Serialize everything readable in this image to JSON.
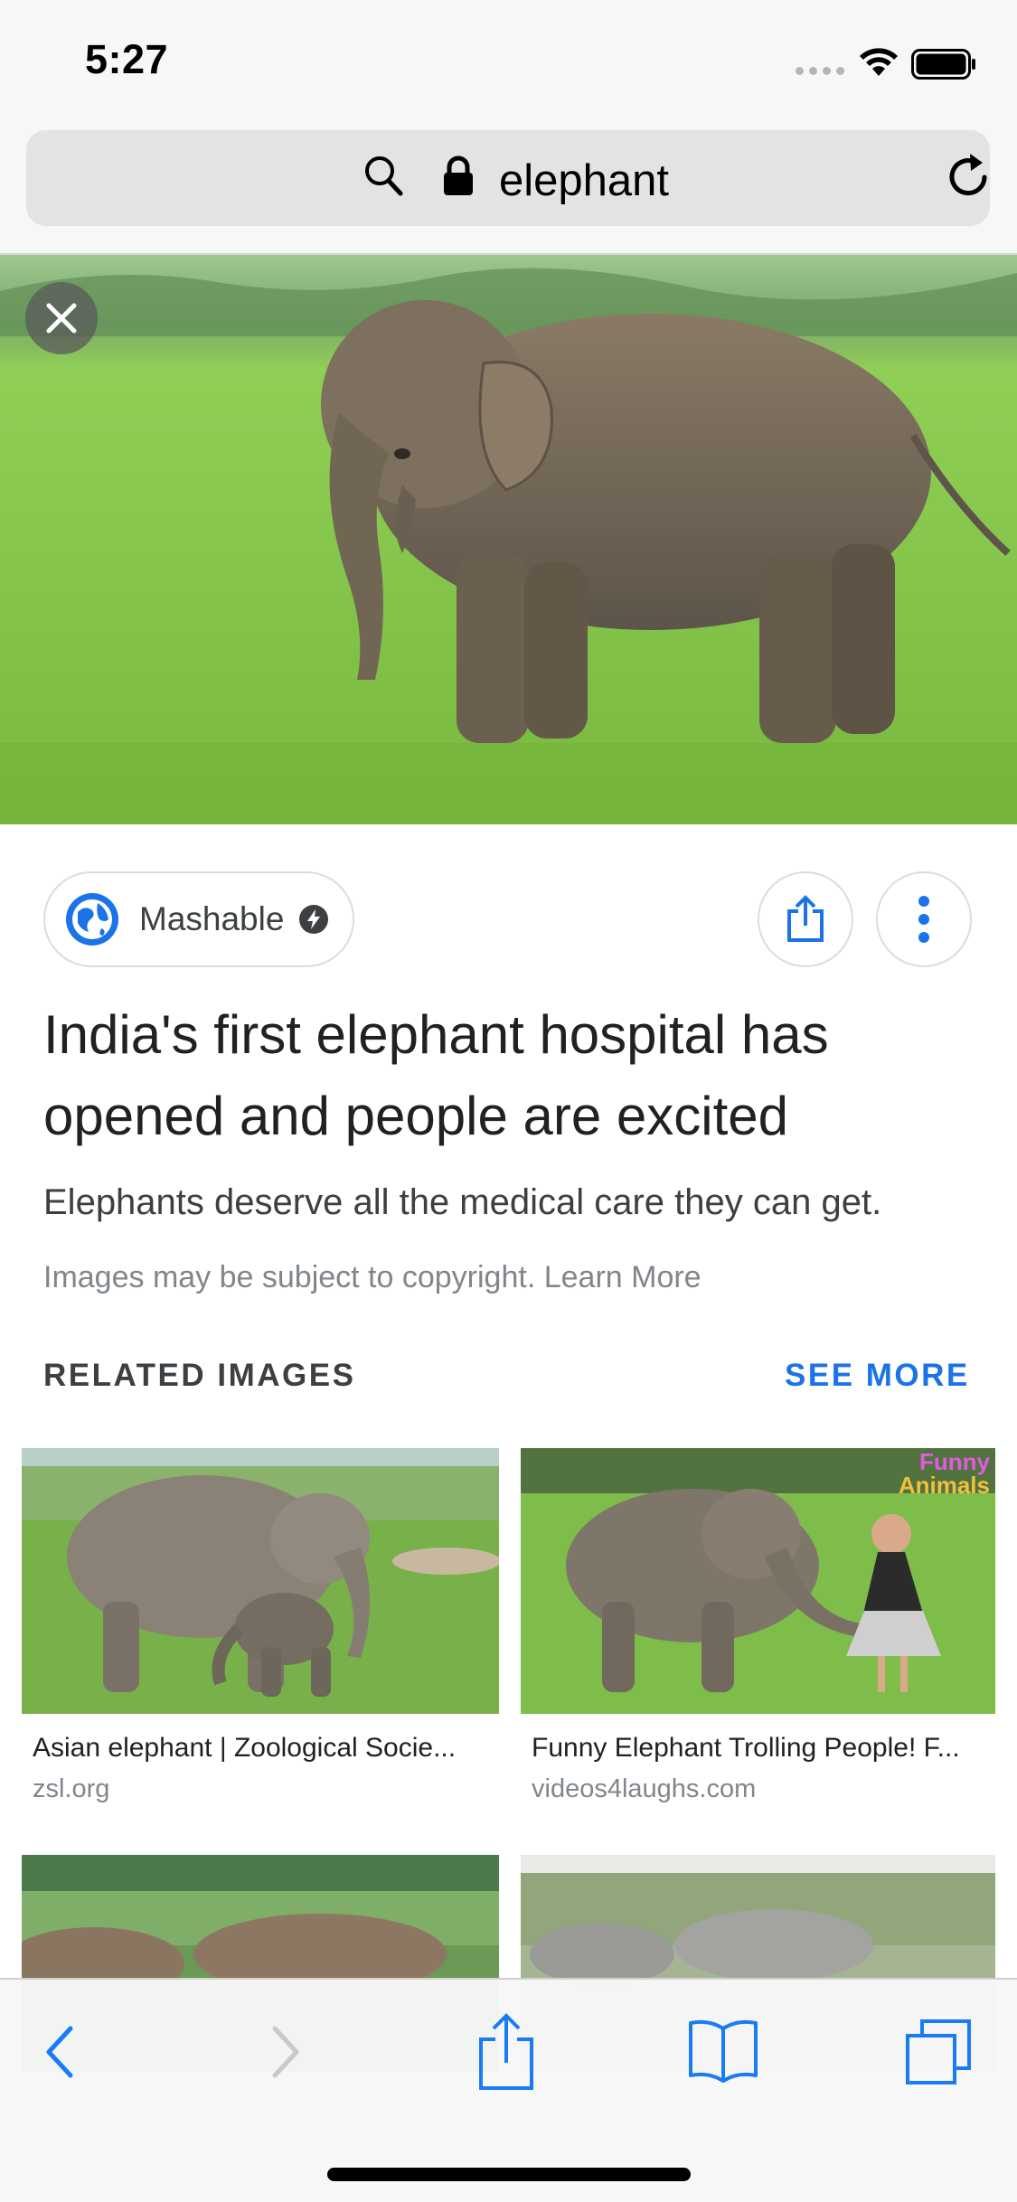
{
  "status_bar": {
    "time": "5:27"
  },
  "url_bar": {
    "query": "elephant"
  },
  "source": {
    "name": "Mashable"
  },
  "article": {
    "title": "India's first elephant hospital has opened and people are excited",
    "description": "Elephants deserve all the medical care they can get.",
    "copyright": "Images may be subject to copyright. Learn More"
  },
  "related": {
    "heading": "RELATED IMAGES",
    "see_more": "SEE MORE",
    "items": [
      {
        "caption": "Asian elephant | Zoological Socie...",
        "site": "zsl.org"
      },
      {
        "caption": "Funny Elephant Trolling People! F...",
        "site": "videos4laughs.com",
        "badge_line1": "Funny",
        "badge_line2": "Animals"
      },
      {
        "caption": "",
        "site": ""
      },
      {
        "caption": "",
        "site": ""
      }
    ]
  },
  "colors": {
    "accent": "#1a73e8",
    "ios_blue": "#1a7cf5"
  }
}
